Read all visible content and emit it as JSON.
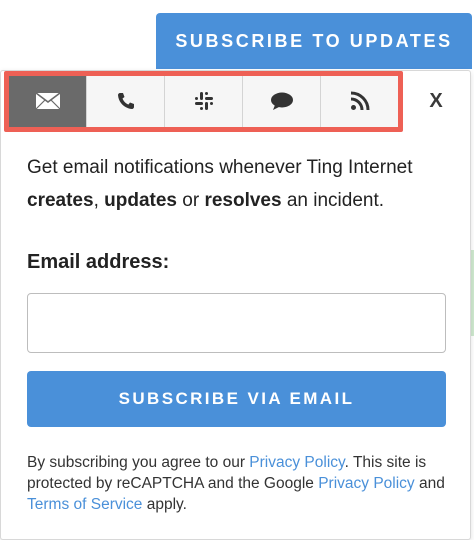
{
  "header": {
    "subscribe_label": "SUBSCRIBE TO UPDATES"
  },
  "tabs": [
    {
      "id": "email",
      "icon": "envelope-icon",
      "active": true
    },
    {
      "id": "phone",
      "icon": "phone-icon",
      "active": false
    },
    {
      "id": "slack",
      "icon": "slack-icon",
      "active": false
    },
    {
      "id": "chat",
      "icon": "speech-bubble-icon",
      "active": false
    },
    {
      "id": "rss",
      "icon": "rss-icon",
      "active": false
    }
  ],
  "close_label": "X",
  "intro": {
    "part1": "Get email notifications whenever Ting Internet ",
    "creates": "creates",
    "sep1": ", ",
    "updates": "updates",
    "sep2": " or ",
    "resolves": "resolves",
    "part2": " an incident."
  },
  "form": {
    "email_label": "Email address:",
    "email_value": "",
    "email_placeholder": "",
    "submit_label": "SUBSCRIBE VIA EMAIL"
  },
  "legal": {
    "t1": "By subscribing you agree to our ",
    "privacy_link": "Privacy Policy",
    "t2": ". This site is protected by reCAPTCHA and the Google ",
    "privacy_link2": "Privacy Policy",
    "t3": " and ",
    "terms_link": "Terms of Service",
    "t4": " apply."
  },
  "colors": {
    "accent": "#4a90d9",
    "highlight": "#ee6055",
    "active_tab": "#6a6a6a"
  }
}
